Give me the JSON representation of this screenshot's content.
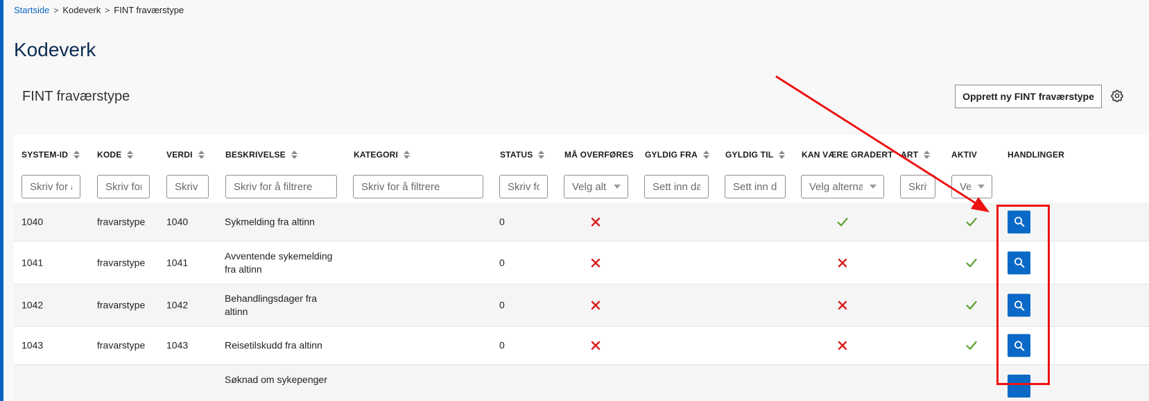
{
  "breadcrumb": {
    "home": "Startside",
    "level1": "Kodeverk",
    "current": "FINT fraværstype"
  },
  "page_title": "Kodeverk",
  "section_title": "FINT fraværstype",
  "create_button": "Opprett ny FINT fraværstype",
  "columns": {
    "system_id": "SYSTEM-ID",
    "kode": "KODE",
    "verdi": "VERDI",
    "beskrivelse": "BESKRIVELSE",
    "kategori": "KATEGORI",
    "status": "STATUS",
    "ma_overfores": "MÅ OVERFØRES",
    "gyldig_fra": "GYLDIG FRA",
    "gyldig_til": "GYLDIG TIL",
    "kan_vaere_gradert": "KAN VÆRE GRADERT",
    "art": "ART",
    "aktiv": "AKTIV",
    "handlinger": "HANDLINGER"
  },
  "filters": {
    "system_id": "Skriv for å filtrere",
    "kode": "Skriv for å filtrere",
    "verdi": "Skriv for å filtrere",
    "beskrivelse": "Skriv for å filtrere",
    "kategori": "Skriv for å filtrere",
    "status": "Skriv for å filtrere",
    "ma_overfores": "Velg alternativ",
    "gyldig_fra": "Sett inn dato",
    "gyldig_til": "Sett inn dato",
    "kan_vaere_gradert": "Velg alternativ",
    "art": "Skriv for å filtrere",
    "aktiv": "Velg alternativ"
  },
  "rows": [
    {
      "system_id": "1040",
      "kode": "fravarstype",
      "verdi": "1040",
      "beskrivelse": "Sykmelding fra altinn",
      "status": "0",
      "ma_overfores": "no",
      "kan_vaere_gradert": "yes",
      "aktiv": "yes"
    },
    {
      "system_id": "1041",
      "kode": "fravarstype",
      "verdi": "1041",
      "beskrivelse": "Avventende sykemelding fra altinn",
      "status": "0",
      "ma_overfores": "no",
      "kan_vaere_gradert": "no",
      "aktiv": "yes"
    },
    {
      "system_id": "1042",
      "kode": "fravarstype",
      "verdi": "1042",
      "beskrivelse": "Behandlingsdager fra altinn",
      "status": "0",
      "ma_overfores": "no",
      "kan_vaere_gradert": "no",
      "aktiv": "yes"
    },
    {
      "system_id": "1043",
      "kode": "fravarstype",
      "verdi": "1043",
      "beskrivelse": "Reisetilskudd fra altinn",
      "status": "0",
      "ma_overfores": "no",
      "kan_vaere_gradert": "no",
      "aktiv": "yes"
    },
    {
      "beskrivelse": "Søknad om sykepenger"
    }
  ],
  "colors": {
    "accent": "#0a63c2",
    "check": "#5aa02c",
    "cross": "#d81b1b",
    "annotation": "#e11111"
  }
}
